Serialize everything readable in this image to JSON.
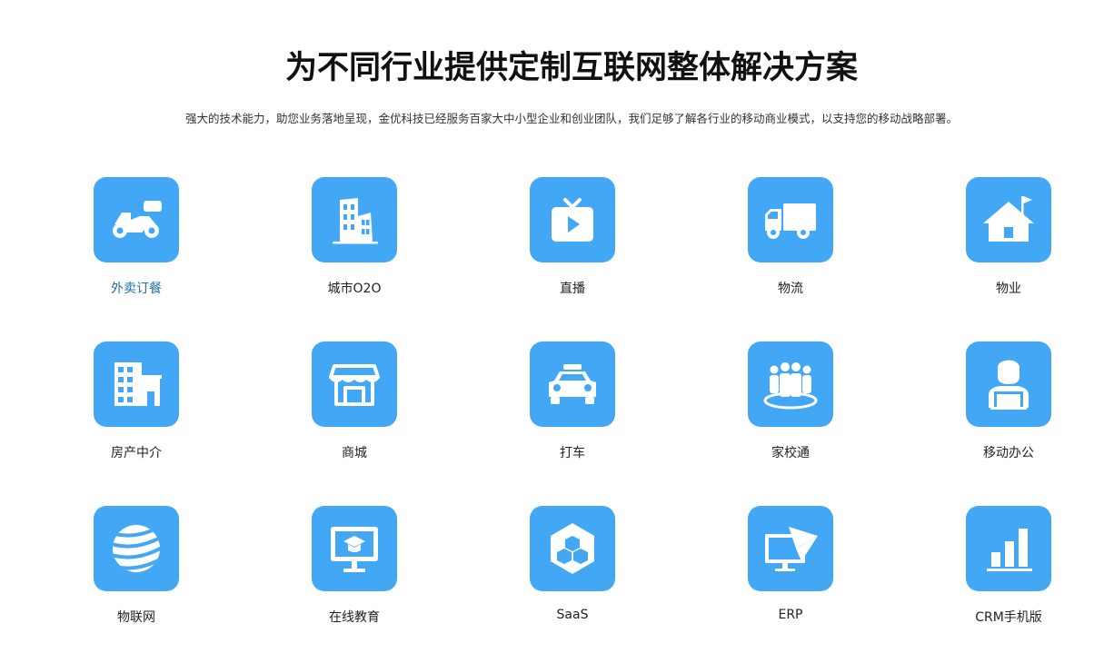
{
  "header": {
    "title": "为不同行业提供定制互联网整体解决方案",
    "subtitle": "强大的技术能力，助您业务落地呈现，金优科技已经服务百家大中小型企业和创业团队，我们足够了解各行业的移动商业模式，以支持您的移动战略部署。"
  },
  "colors": {
    "icon_background": "#42a7f5",
    "icon_foreground": "#ffffff",
    "active_label": "#1f6fa8",
    "label": "#222222"
  },
  "industries": [
    {
      "label": "外卖订餐",
      "icon": "scooter-icon",
      "active": true
    },
    {
      "label": "城市O2O",
      "icon": "city-buildings-icon",
      "active": false
    },
    {
      "label": "直播",
      "icon": "tv-play-icon",
      "active": false
    },
    {
      "label": "物流",
      "icon": "truck-icon",
      "active": false
    },
    {
      "label": "物业",
      "icon": "house-flag-icon",
      "active": false
    },
    {
      "label": "房产中介",
      "icon": "apartment-building-icon",
      "active": false
    },
    {
      "label": "商城",
      "icon": "storefront-icon",
      "active": false
    },
    {
      "label": "打车",
      "icon": "taxi-icon",
      "active": false
    },
    {
      "label": "家校通",
      "icon": "people-group-icon",
      "active": false
    },
    {
      "label": "移动办公",
      "icon": "office-worker-icon",
      "active": false
    },
    {
      "label": "物联网",
      "icon": "globe-icon",
      "active": false
    },
    {
      "label": "在线教育",
      "icon": "monitor-graduation-cap-icon",
      "active": false
    },
    {
      "label": "SaaS",
      "icon": "hexagon-cubes-icon",
      "active": false
    },
    {
      "label": "ERP",
      "icon": "monitor-paper-plane-icon",
      "active": false
    },
    {
      "label": "CRM手机版",
      "icon": "bar-chart-icon",
      "active": false
    }
  ]
}
